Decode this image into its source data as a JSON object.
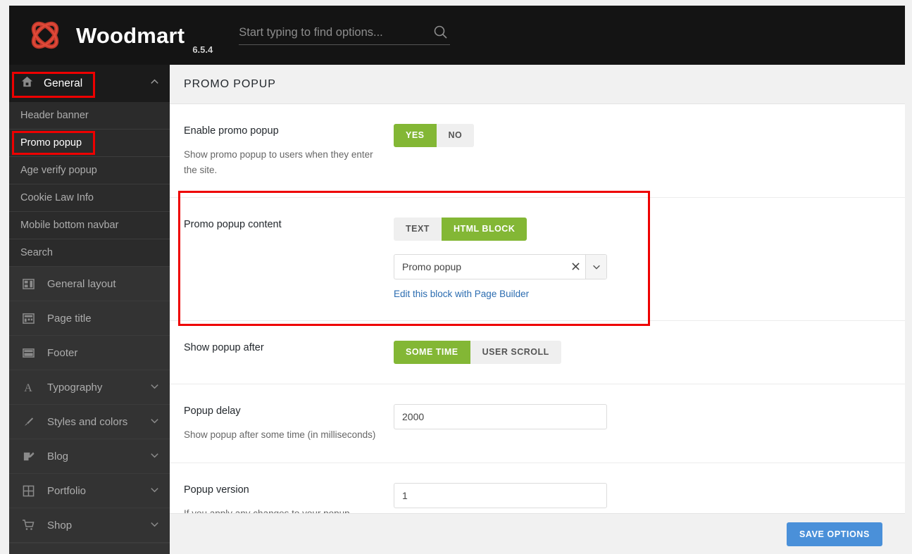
{
  "header": {
    "brand": "Woodmart",
    "version": "6.5.4",
    "search_placeholder": "Start typing to find options...",
    "search_value": "",
    "search_icon": "search-icon",
    "logo_icon": "woodmart-logo-icon"
  },
  "sidebar": {
    "group": {
      "label": "General",
      "icon": "home-icon",
      "chevron": "chevron-up-icon"
    },
    "sub_items": [
      {
        "label": "Header banner",
        "active": false
      },
      {
        "label": "Promo popup",
        "active": true
      },
      {
        "label": "Age verify popup",
        "active": false
      },
      {
        "label": "Cookie Law Info",
        "active": false
      },
      {
        "label": "Mobile bottom navbar",
        "active": false
      },
      {
        "label": "Search",
        "active": false
      }
    ],
    "main_items": [
      {
        "label": "General layout",
        "icon": "layout-icon",
        "chevron": false
      },
      {
        "label": "Page title",
        "icon": "page-title-icon",
        "chevron": false
      },
      {
        "label": "Footer",
        "icon": "footer-icon",
        "chevron": false
      },
      {
        "label": "Typography",
        "icon": "typography-icon",
        "chevron": true
      },
      {
        "label": "Styles and colors",
        "icon": "brush-icon",
        "chevron": true
      },
      {
        "label": "Blog",
        "icon": "blog-icon",
        "chevron": true
      },
      {
        "label": "Portfolio",
        "icon": "portfolio-icon",
        "chevron": true
      },
      {
        "label": "Shop",
        "icon": "cart-icon",
        "chevron": true
      }
    ]
  },
  "main": {
    "page_title": "PROMO POPUP",
    "rows": {
      "enable": {
        "title": "Enable promo popup",
        "desc": "Show promo popup to users when they enter the site.",
        "options": [
          "YES",
          "NO"
        ],
        "selected": "YES"
      },
      "content": {
        "title": "Promo popup content",
        "options": [
          "TEXT",
          "HTML BLOCK"
        ],
        "selected": "HTML BLOCK",
        "select_value": "Promo popup",
        "clear_icon": "close-icon",
        "arrow_icon": "chevron-down-icon",
        "edit_link": "Edit this block with Page Builder"
      },
      "show_after": {
        "title": "Show popup after",
        "options": [
          "SOME TIME",
          "USER SCROLL"
        ],
        "selected": "SOME TIME"
      },
      "delay": {
        "title": "Popup delay",
        "desc": "Show popup after some time (in milliseconds)",
        "value": "2000"
      },
      "version": {
        "title": "Popup version",
        "desc": "If you apply any changes to your popup settings",
        "value": "1"
      }
    },
    "save_label": "SAVE OPTIONS"
  },
  "colors": {
    "accent_green": "#83b735",
    "save_blue": "#4a90d9",
    "annotation_red": "#ee0000",
    "link_blue": "#2b6cb0"
  }
}
